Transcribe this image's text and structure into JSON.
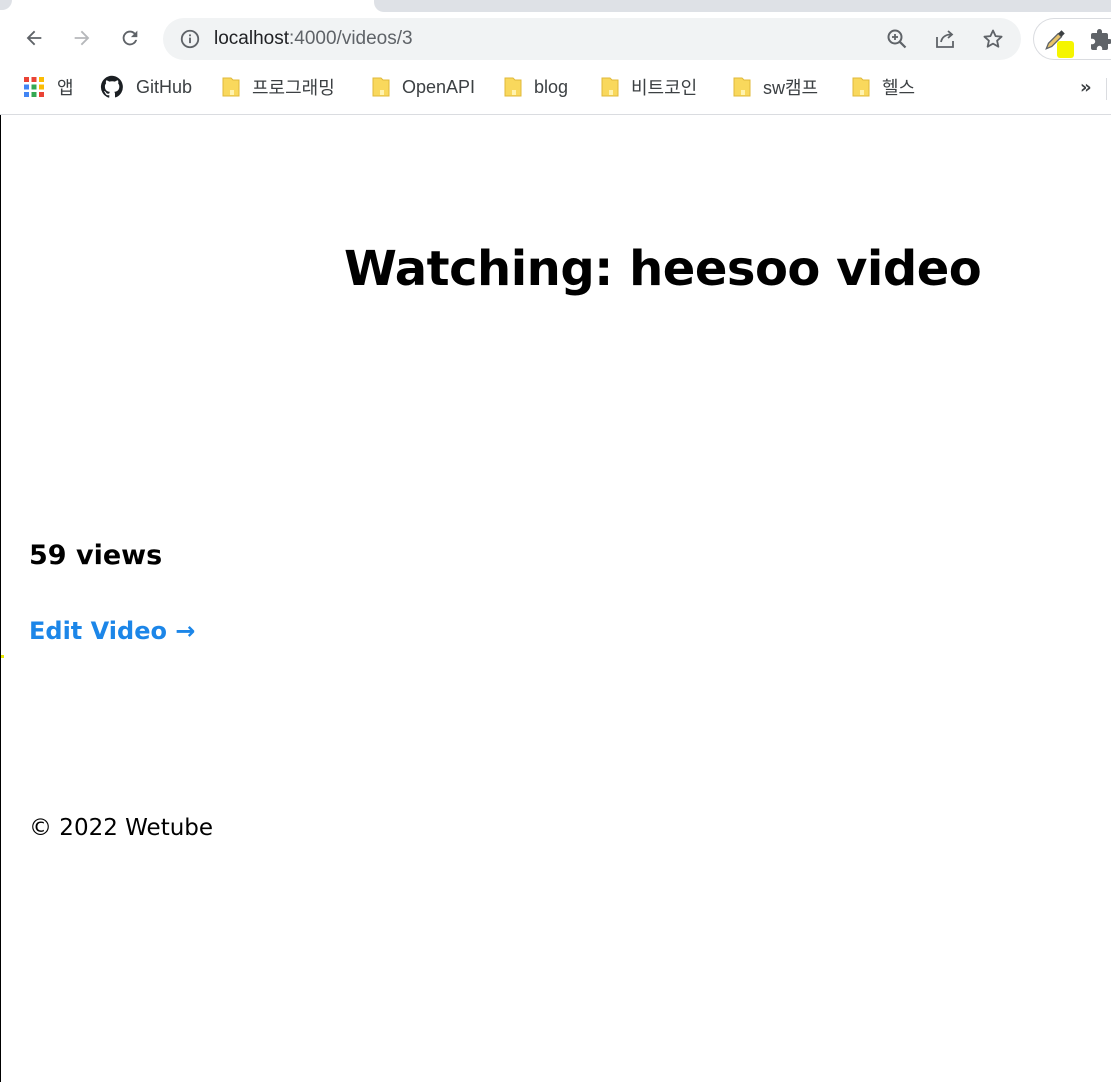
{
  "browser": {
    "url_host": "localhost",
    "url_path": ":4000/videos/3",
    "bookmarks": [
      {
        "label": "앱",
        "icon": "apps-grid-icon"
      },
      {
        "label": "GitHub",
        "icon": "github-icon"
      },
      {
        "label": "프로그래밍",
        "icon": "folder-icon"
      },
      {
        "label": "OpenAPI",
        "icon": "folder-icon"
      },
      {
        "label": "blog",
        "icon": "folder-icon"
      },
      {
        "label": "비트코인",
        "icon": "folder-icon"
      },
      {
        "label": "sw캠프",
        "icon": "folder-icon"
      },
      {
        "label": "헬스",
        "icon": "folder-icon"
      }
    ],
    "overflow_label": "»"
  },
  "page": {
    "title": "Watching: heesoo video",
    "views": "59 views",
    "edit_link": "Edit Video →",
    "footer": "© 2022 Wetube"
  },
  "colors": {
    "link": "#1c86e8",
    "folder": "#f9d85c",
    "ext_badge": "#f5f500"
  }
}
